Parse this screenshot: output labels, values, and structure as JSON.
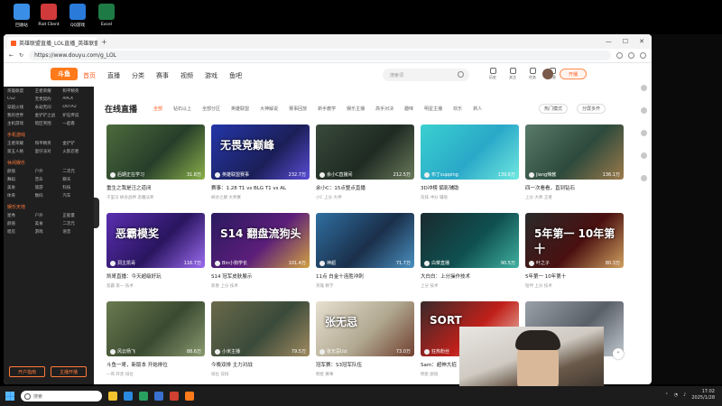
{
  "desktop": {
    "icons": [
      {
        "label": "回收站",
        "color": "#3a8ee6"
      },
      {
        "label": "Riot Client",
        "color": "#d13a3a"
      },
      {
        "label": "QQ游戏",
        "color": "#2a7ad9"
      },
      {
        "label": "Excel",
        "color": "#1e7a45"
      }
    ]
  },
  "browser": {
    "tab_title": "英雄联盟直播_LOL直播_英雄联盟比赛...",
    "address": "https://www.douyu.com/g_LOL"
  },
  "site": {
    "logo": "斗鱼",
    "nav": [
      "首页",
      "直播",
      "分类",
      "赛事",
      "视频",
      "游戏",
      "鱼吧"
    ],
    "search_placeholder": "搜索词",
    "header_icons": [
      "历史",
      "关注",
      "任务",
      "消息"
    ],
    "open_button": "开播"
  },
  "sidebar": {
    "groups": [
      {
        "head": "",
        "items": [
          "英雄联盟",
          "王者荣耀",
          "和平精英",
          "CS2",
          "无畏契约",
          "APEX",
          "穿越火线",
          "永劫无间",
          "DOTA2",
          "我的世界",
          "金铲铲之战",
          "炉石传说",
          "主机游戏",
          "暗区突围",
          "一起看"
        ]
      },
      {
        "head": "手机游戏",
        "items": [
          "王者荣耀",
          "和平精英",
          "金铲铲",
          "第五人格",
          "蛋仔派对",
          "火影忍者"
        ]
      },
      {
        "head": "休闲娱乐",
        "items": [
          "颜值",
          "户外",
          "二次元",
          "舞蹈",
          "音乐",
          "聊天",
          "美食",
          "旅游",
          "科技",
          "体育",
          "数码",
          "汽车"
        ]
      },
      {
        "head": "娱乐天地",
        "items": [
          "星秀",
          "户外",
          "正能量",
          "颜值",
          "美食",
          "二次元",
          "唱见",
          "游戏",
          "语音"
        ]
      }
    ],
    "buttons": [
      "开户指南",
      "主播开播"
    ]
  },
  "content": {
    "section_title": "在线直播",
    "filters": [
      "全部",
      "钻石以上",
      "全部分区",
      "英雄联盟",
      "大神解说",
      "赛事回放",
      "新手教学",
      "娱乐主播",
      "高手对决",
      "趣味",
      "明星主播",
      "欢乐",
      "新人"
    ],
    "view_tools": [
      "热门模式",
      "分屏多开"
    ]
  },
  "streams": [
    {
      "streamer": "后期正在学习",
      "viewers": "31.8万",
      "title": "重生之我是汪之道闭",
      "tags": "千里马 峡谷战神 恶魔法师",
      "overlay": "",
      "theme": "t1"
    },
    {
      "streamer": "英雄联盟赛事",
      "viewers": "232.7万",
      "title": "赛事：1.28 T1 vs BLG T1 vs AL",
      "tags": "峡谷之巅 大师赛",
      "overlay": "无畏竞巅峰",
      "theme": "t2"
    },
    {
      "streamer": "余小C直播间",
      "viewers": "212.5万",
      "title": "余小C：15点整点直播",
      "tags": "小C 上分 大神",
      "overlay": "",
      "theme": "t3"
    },
    {
      "streamer": "布丁supping",
      "viewers": "139.6万",
      "title": "3D冲榜 狐影辅助",
      "tags": "双排 冲分 辅助",
      "overlay": "",
      "theme": "t4"
    },
    {
      "streamer": "jiang辣酱",
      "viewers": "136.1万",
      "title": "四一次看看，直到钻石",
      "tags": "上分 大师 王者",
      "overlay": "",
      "theme": "t5"
    },
    {
      "streamer": "洞主凯哥",
      "viewers": "116.7万",
      "title": "凯哥直播：今天超级好玩",
      "tags": "恶霸 第一 技术",
      "overlay": "恶霸模奖",
      "theme": "t6"
    },
    {
      "streamer": "Bin小狗学长",
      "viewers": "101.4万",
      "title": "S14 冠军皮肤展示",
      "tags": "新春 上分 技术",
      "overlay": "S14 翻盘流狗头",
      "theme": "t7"
    },
    {
      "streamer": "神超",
      "viewers": "71.7万",
      "title": "11点 白金十连胜冲刺",
      "tags": "英雄 教学",
      "overlay": "",
      "theme": "t8"
    },
    {
      "streamer": "白菜直播",
      "viewers": "90.5万",
      "title": "大白白：上分操作技术",
      "tags": "上分 技术",
      "overlay": "",
      "theme": "t9"
    },
    {
      "streamer": "叶之子",
      "viewers": "80.3万",
      "title": "5年第一 10年第十",
      "tags": "陪伴 上分 技术",
      "overlay": "5年第一 10年第十",
      "theme": "t10"
    },
    {
      "streamer": "风云杨飞",
      "viewers": "88.6万",
      "title": "斗鱼一哥，新版本 开始排位",
      "tags": "一哥 开黑 排位",
      "overlay": "",
      "theme": "t11"
    },
    {
      "streamer": "小米主播",
      "viewers": "79.5万",
      "title": "今晚双排 主力对战",
      "tags": "排位 双排",
      "overlay": "",
      "theme": "t12"
    },
    {
      "streamer": "张无忌Uzi",
      "viewers": "73.0万",
      "title": "冠军赛：S3冠军队伍",
      "tags": "明星 赛事",
      "overlay": "张无忌",
      "theme": "t13"
    },
    {
      "streamer": "狂热粉丝",
      "viewers": "74.2万",
      "title": "Sam：超神大招",
      "tags": "明星 颜值",
      "overlay": "SORT",
      "theme": "t14"
    },
    {
      "streamer": "",
      "viewers": "",
      "title": "峡谷之巅",
      "tags": "",
      "overlay": "",
      "theme": "t15"
    }
  ],
  "taskbar": {
    "search_placeholder": "搜索",
    "time": "17:02",
    "date": "2025/1/28"
  }
}
